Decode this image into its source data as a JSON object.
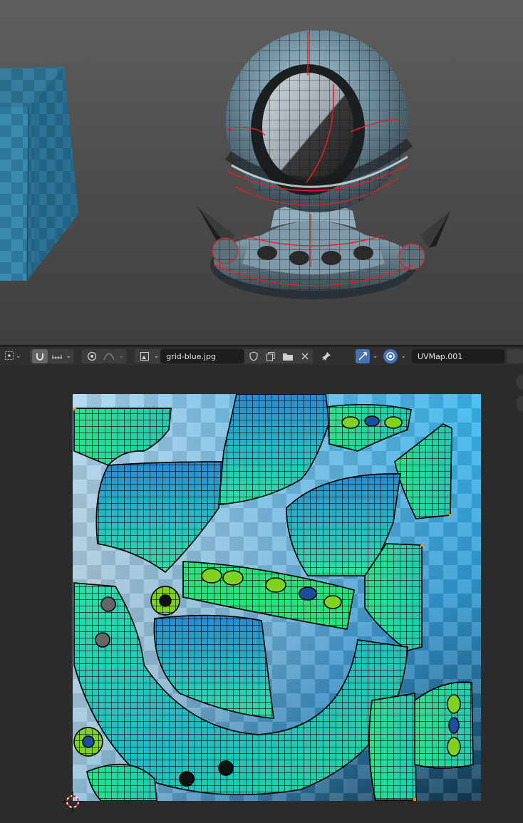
{
  "image_editor": {
    "image_name": "grid-blue.jpg",
    "uv_map": "UVMap.001"
  },
  "icons": {
    "pivot": "pivot-point-icon",
    "snap": "snap-magnet-icon",
    "snap_type": "snap-increment-icon",
    "proportional": "proportional-edit-icon",
    "falloff": "falloff-curve-icon",
    "image_type": "image-icon",
    "fake_user": "shield-icon",
    "new_image": "duplicate-icon",
    "open_image": "folder-icon",
    "unlink": "close-icon",
    "pin": "pin-icon",
    "sticky_select": "uv-sync-select-icon",
    "display_channels": "display-channel-icon"
  },
  "colors": {
    "uv_island_fill": "#27e0a0",
    "uv_island_stretch": "#2a90d0",
    "uv_island_select": "#7ed321",
    "seam": "#e02020",
    "header_active": "#4772b3"
  }
}
